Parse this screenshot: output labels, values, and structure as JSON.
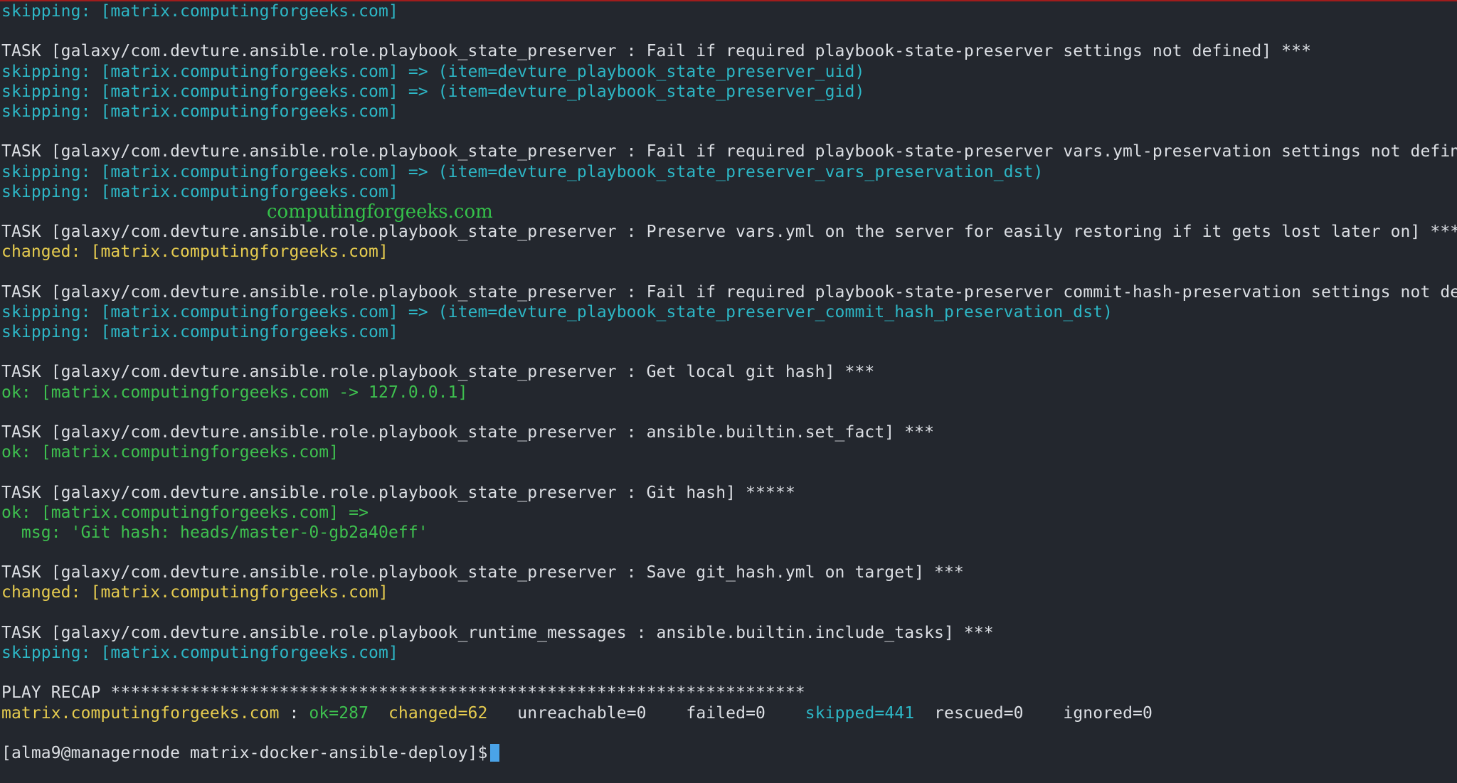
{
  "colors": {
    "background": "#23272e",
    "text": "#dcdfe4",
    "skipping": "#2db7c6",
    "changed": "#e6cc4f",
    "ok": "#3ec04f",
    "watermark": "#35c24a",
    "top_border": "#a01c1c",
    "cursor": "#4aa3e8"
  },
  "terminal": {
    "lines": [
      {
        "segments": [
          {
            "text": "skipping: [matrix.computingforgeeks.com]",
            "color": "cyan"
          }
        ]
      },
      {
        "segments": []
      },
      {
        "segments": [
          {
            "text": "TASK [galaxy/com.devture.ansible.role.playbook_state_preserver : Fail if required playbook-state-preserver settings not defined] ***",
            "color": "white"
          }
        ]
      },
      {
        "segments": [
          {
            "text": "skipping: [matrix.computingforgeeks.com] => (item=devture_playbook_state_preserver_uid)",
            "color": "cyan"
          }
        ]
      },
      {
        "segments": [
          {
            "text": "skipping: [matrix.computingforgeeks.com] => (item=devture_playbook_state_preserver_gid)",
            "color": "cyan"
          }
        ]
      },
      {
        "segments": [
          {
            "text": "skipping: [matrix.computingforgeeks.com]",
            "color": "cyan"
          }
        ]
      },
      {
        "segments": []
      },
      {
        "segments": [
          {
            "text": "TASK [galaxy/com.devture.ansible.role.playbook_state_preserver : Fail if required playbook-state-preserver vars.yml-preservation settings not defined] ***",
            "color": "white"
          }
        ]
      },
      {
        "segments": [
          {
            "text": "skipping: [matrix.computingforgeeks.com] => (item=devture_playbook_state_preserver_vars_preservation_dst)",
            "color": "cyan"
          }
        ]
      },
      {
        "segments": [
          {
            "text": "skipping: [matrix.computingforgeeks.com]",
            "color": "cyan"
          }
        ]
      },
      {
        "segments": []
      },
      {
        "segments": [
          {
            "text": "TASK [galaxy/com.devture.ansible.role.playbook_state_preserver : Preserve vars.yml on the server for easily restoring if it gets lost later on] ***",
            "color": "white"
          }
        ]
      },
      {
        "segments": [
          {
            "text": "changed: [matrix.computingforgeeks.com]",
            "color": "yellow"
          }
        ]
      },
      {
        "segments": []
      },
      {
        "segments": [
          {
            "text": "TASK [galaxy/com.devture.ansible.role.playbook_state_preserver : Fail if required playbook-state-preserver commit-hash-preservation settings not defined] ***",
            "color": "white"
          }
        ]
      },
      {
        "segments": [
          {
            "text": "skipping: [matrix.computingforgeeks.com] => (item=devture_playbook_state_preserver_commit_hash_preservation_dst)",
            "color": "cyan"
          }
        ]
      },
      {
        "segments": [
          {
            "text": "skipping: [matrix.computingforgeeks.com]",
            "color": "cyan"
          }
        ]
      },
      {
        "segments": []
      },
      {
        "segments": [
          {
            "text": "TASK [galaxy/com.devture.ansible.role.playbook_state_preserver : Get local git hash] ***",
            "color": "white"
          }
        ]
      },
      {
        "segments": [
          {
            "text": "ok: [matrix.computingforgeeks.com -> 127.0.0.1]",
            "color": "green"
          }
        ]
      },
      {
        "segments": []
      },
      {
        "segments": [
          {
            "text": "TASK [galaxy/com.devture.ansible.role.playbook_state_preserver : ansible.builtin.set_fact] ***",
            "color": "white"
          }
        ]
      },
      {
        "segments": [
          {
            "text": "ok: [matrix.computingforgeeks.com]",
            "color": "green"
          }
        ]
      },
      {
        "segments": []
      },
      {
        "segments": [
          {
            "text": "TASK [galaxy/com.devture.ansible.role.playbook_state_preserver : Git hash] *****",
            "color": "white"
          }
        ]
      },
      {
        "segments": [
          {
            "text": "ok: [matrix.computingforgeeks.com] =>",
            "color": "green"
          }
        ]
      },
      {
        "segments": [
          {
            "text": "  msg: 'Git hash: heads/master-0-gb2a40eff'",
            "color": "green"
          }
        ]
      },
      {
        "segments": []
      },
      {
        "segments": [
          {
            "text": "TASK [galaxy/com.devture.ansible.role.playbook_state_preserver : Save git_hash.yml on target] ***",
            "color": "white"
          }
        ]
      },
      {
        "segments": [
          {
            "text": "changed: [matrix.computingforgeeks.com]",
            "color": "yellow"
          }
        ]
      },
      {
        "segments": []
      },
      {
        "segments": [
          {
            "text": "TASK [galaxy/com.devture.ansible.role.playbook_runtime_messages : ansible.builtin.include_tasks] ***",
            "color": "white"
          }
        ]
      },
      {
        "segments": [
          {
            "text": "skipping: [matrix.computingforgeeks.com]",
            "color": "cyan"
          }
        ]
      },
      {
        "segments": []
      },
      {
        "segments": [
          {
            "text": "PLAY RECAP **********************************************************************",
            "color": "white"
          }
        ]
      },
      {
        "segments": [
          {
            "text": "matrix.computingforgeeks.com",
            "color": "yellow"
          },
          {
            "text": " : ",
            "color": "white"
          },
          {
            "text": "ok=287",
            "color": "green"
          },
          {
            "text": "  ",
            "color": "white"
          },
          {
            "text": "changed=62",
            "color": "yellow"
          },
          {
            "text": "   unreachable=0    failed=0    ",
            "color": "white"
          },
          {
            "text": "skipped=441",
            "color": "cyan"
          },
          {
            "text": "  rescued=0    ignored=0",
            "color": "white"
          }
        ]
      },
      {
        "segments": []
      },
      {
        "segments": [
          {
            "text": "[alma9@managernode matrix-docker-ansible-deploy]$",
            "color": "white"
          }
        ],
        "cursor": true
      }
    ]
  },
  "watermark": {
    "text": "computingforgeeks.com"
  }
}
